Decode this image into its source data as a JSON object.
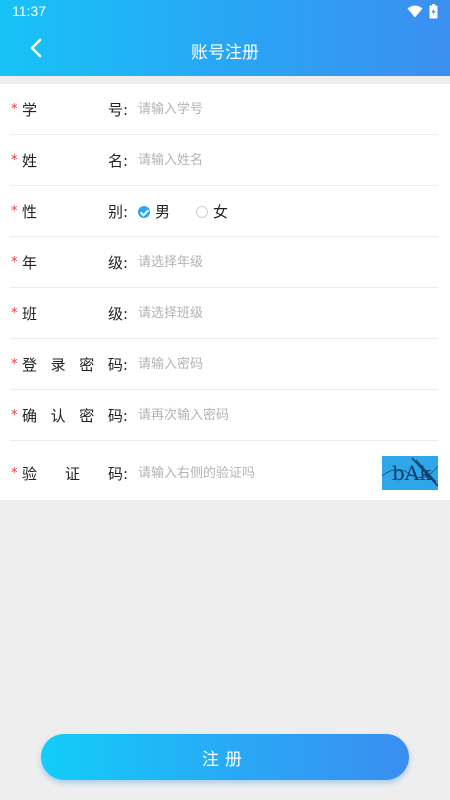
{
  "status_bar": {
    "time": "11:37"
  },
  "header": {
    "title": "账号注册"
  },
  "form": {
    "student_id": {
      "label_left": "学",
      "label_right": "号:",
      "placeholder": "请输入学号"
    },
    "name": {
      "label_left": "姓",
      "label_right": "名:",
      "placeholder": "请输入姓名"
    },
    "gender": {
      "label_left": "性",
      "label_right": "别:",
      "options": [
        {
          "label": "男",
          "checked": true
        },
        {
          "label": "女",
          "checked": false
        }
      ]
    },
    "grade": {
      "label_left": "年",
      "label_right": "级:",
      "placeholder": "请选择年级"
    },
    "class": {
      "label_left": "班",
      "label_right": "级:",
      "placeholder": "请选择班级"
    },
    "password": {
      "label_chars": [
        "登",
        "录",
        "密",
        "码:"
      ],
      "placeholder": "请输入密码"
    },
    "confirm_password": {
      "label_chars": [
        "确",
        "认",
        "密",
        "码:"
      ],
      "placeholder": "请再次输入密码"
    },
    "captcha": {
      "label_chars": [
        "验",
        "证",
        "码:"
      ],
      "placeholder": "请输入右侧的验证吗",
      "image_text": "bAk"
    }
  },
  "required_mark": "*",
  "register_button": {
    "label": "注册"
  },
  "colors": {
    "accent": "#2aa4f4",
    "required": "#e53935",
    "background": "#eeeeee"
  }
}
